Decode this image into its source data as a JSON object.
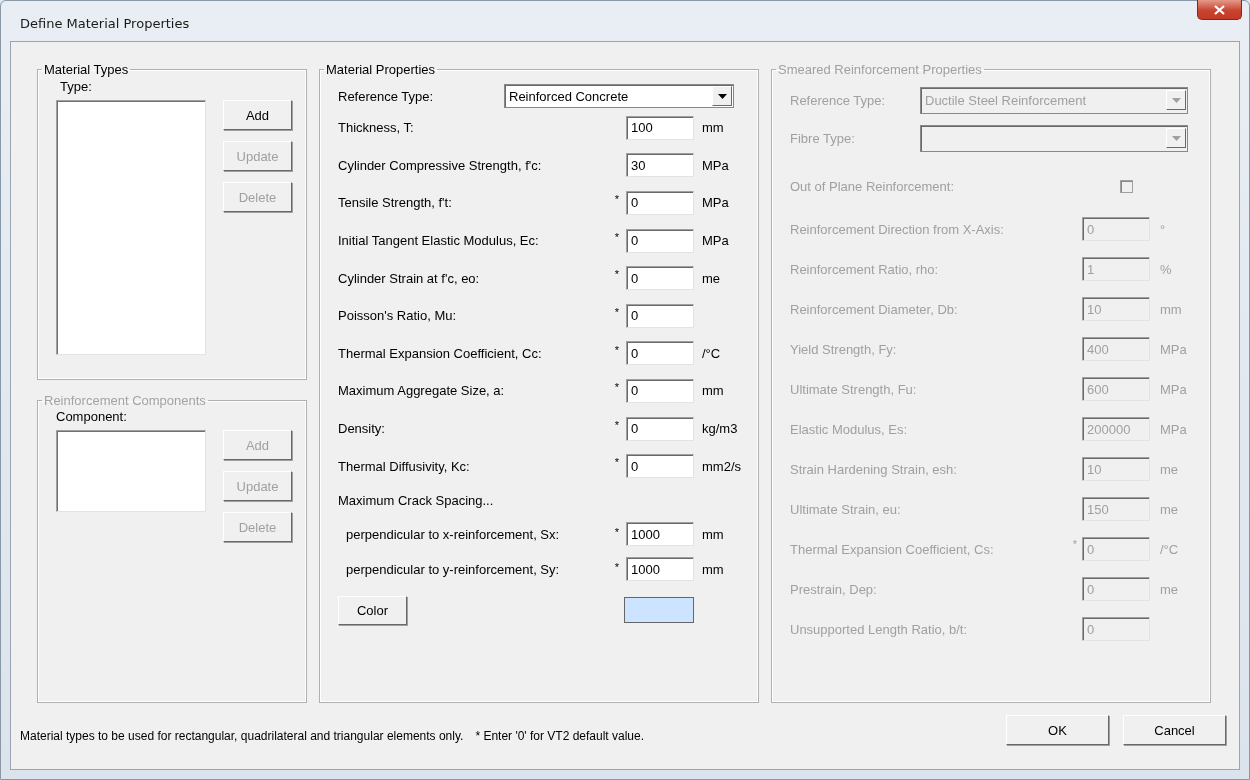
{
  "window": {
    "title": "Define Material Properties"
  },
  "material_types": {
    "title": "Material Types",
    "disabled": false,
    "list_label": "Type:",
    "buttons": [
      {
        "label": "Add",
        "disabled": false
      },
      {
        "label": "Update",
        "disabled": true
      },
      {
        "label": "Delete",
        "disabled": true
      }
    ]
  },
  "reinforcement_components": {
    "title": "Reinforcement Components",
    "disabled": true,
    "list_label": "Component:",
    "buttons": [
      {
        "label": "Add",
        "disabled": true
      },
      {
        "label": "Update",
        "disabled": true
      },
      {
        "label": "Delete",
        "disabled": true
      }
    ]
  },
  "material_properties": {
    "title": "Material Properties",
    "disabled": false,
    "reference_type": {
      "label": "Reference Type:",
      "value": "Reinforced Concrete"
    },
    "fields": [
      {
        "label": "Thickness, T:",
        "value": "100",
        "unit": "mm"
      },
      {
        "label": "Cylinder Compressive Strength, f'c:",
        "value": "30",
        "unit": "MPa"
      },
      {
        "label": "Tensile Strength, f't:",
        "marker": "*",
        "value": "0",
        "unit": "MPa"
      },
      {
        "label": "Initial Tangent Elastic Modulus, Ec:",
        "marker": "*",
        "value": "0",
        "unit": "MPa"
      },
      {
        "label": "Cylinder Strain at f'c, eo:",
        "marker": "*",
        "value": "0",
        "unit": "me"
      },
      {
        "label": "Poisson's Ratio, Mu:",
        "marker": "*",
        "value": "0"
      },
      {
        "label": "Thermal Expansion Coefficient, Cc:",
        "marker": "*",
        "value": "0",
        "unit": "/°C"
      },
      {
        "label": "Maximum Aggregate Size, a:",
        "marker": "*",
        "value": "0",
        "unit": "mm"
      },
      {
        "label": "Density:",
        "marker": "*",
        "value": "0",
        "unit": "kg/m3"
      },
      {
        "label": "Thermal Diffusivity, Kc:",
        "marker": "*",
        "value": "0",
        "unit": "mm2/s"
      }
    ],
    "crack_spacing_heading": "Maximum Crack Spacing...",
    "crack_fields": [
      {
        "label": "perpendicular to x-reinforcement, Sx:",
        "marker": "*",
        "value": "1000",
        "unit": "mm"
      },
      {
        "label": "perpendicular to y-reinforcement, Sy:",
        "marker": "*",
        "value": "1000",
        "unit": "mm"
      }
    ],
    "color_button": "Color",
    "color_swatch": {
      "color": "#cce4ff"
    }
  },
  "smeared_reinforcement": {
    "title": "Smeared Reinforcement Properties",
    "disabled": true,
    "reference_type": {
      "label": "Reference Type:",
      "value": "Ductile Steel Reinforcement"
    },
    "fibre_type": {
      "label": "Fibre Type:"
    },
    "out_of_plane": {
      "label": "Out of Plane Reinforcement:",
      "checked": false
    },
    "fields": [
      {
        "label": "Reinforcement Direction from X-Axis:",
        "value": "0",
        "unit": "°"
      },
      {
        "label": "Reinforcement Ratio, rho:",
        "value": "1",
        "unit": "%"
      },
      {
        "label": "Reinforcement Diameter, Db:",
        "value": "10",
        "unit": "mm"
      },
      {
        "label": "Yield Strength, Fy:",
        "value": "400",
        "unit": "MPa"
      },
      {
        "label": "Ultimate Strength, Fu:",
        "value": "600",
        "unit": "MPa"
      },
      {
        "label": "Elastic Modulus, Es:",
        "value": "200000",
        "unit": "MPa"
      },
      {
        "label": "Strain Hardening Strain, esh:",
        "value": "10",
        "unit": "me"
      },
      {
        "label": "Ultimate Strain, eu:",
        "value": "150",
        "unit": "me"
      },
      {
        "label": "Thermal Expansion Coefficient, Cs:",
        "marker": "*",
        "value": "0",
        "unit": "/°C"
      },
      {
        "label": "Prestrain, Dep:",
        "value": "0",
        "unit": "me"
      },
      {
        "label": "Unsupported Length Ratio, b/t:",
        "value": "0"
      }
    ]
  },
  "footer_note": "Material types to be used for rectangular, quadrilateral and triangular elements only.",
  "default_note": "* Enter '0' for VT2 default value.",
  "buttons": [
    {
      "label": "OK"
    },
    {
      "label": "Cancel"
    }
  ]
}
